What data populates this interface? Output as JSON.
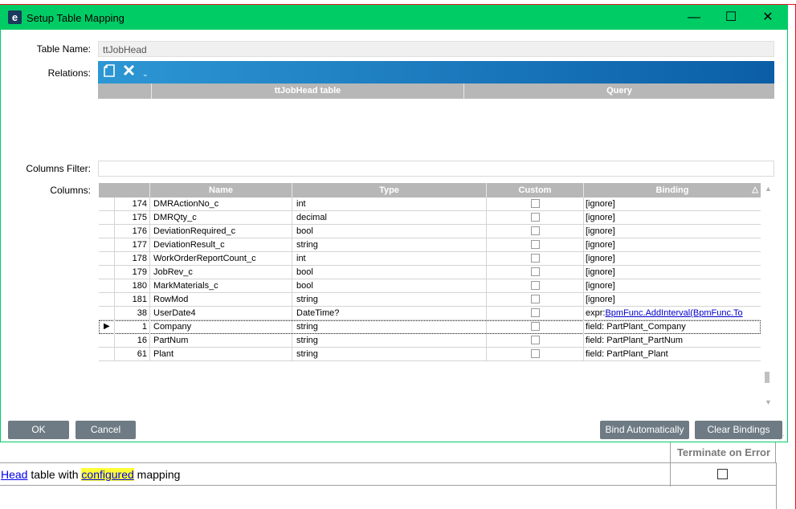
{
  "window": {
    "title": "Setup Table Mapping",
    "icon_letter": "e",
    "minimize_glyph": "—",
    "maximize_glyph": "☐",
    "close_glyph": "✕"
  },
  "form": {
    "table_name_label": "Table Name:",
    "table_name_value": "ttJobHead",
    "relations_label": "Relations:",
    "columns_filter_label": "Columns Filter:",
    "columns_filter_value": "",
    "columns_label": "Columns:"
  },
  "relations": {
    "toolbar_icons": [
      "new-document-icon",
      "delete-x-icon",
      "dropdown-caret-icon"
    ],
    "headers": [
      "ttJobHead table",
      "Query"
    ]
  },
  "columns_grid": {
    "headers": [
      "Name",
      "Type",
      "Custom",
      "Binding"
    ],
    "rows": [
      {
        "num": "174",
        "name": "DMRActionNo_c",
        "type": "int",
        "custom": false,
        "binding_prefix": "",
        "binding": "[ignore]"
      },
      {
        "num": "175",
        "name": "DMRQty_c",
        "type": "decimal",
        "custom": false,
        "binding_prefix": "",
        "binding": "[ignore]"
      },
      {
        "num": "176",
        "name": "DeviationRequired_c",
        "type": "bool",
        "custom": false,
        "binding_prefix": "",
        "binding": "[ignore]"
      },
      {
        "num": "177",
        "name": "DeviationResult_c",
        "type": "string",
        "custom": false,
        "binding_prefix": "",
        "binding": "[ignore]"
      },
      {
        "num": "178",
        "name": "WorkOrderReportCount_c",
        "type": "int",
        "custom": false,
        "binding_prefix": "",
        "binding": "[ignore]"
      },
      {
        "num": "179",
        "name": "JobRev_c",
        "type": "bool",
        "custom": false,
        "binding_prefix": "",
        "binding": "[ignore]"
      },
      {
        "num": "180",
        "name": "MarkMaterials_c",
        "type": "bool",
        "custom": false,
        "binding_prefix": "",
        "binding": "[ignore]"
      },
      {
        "num": "181",
        "name": "RowMod",
        "type": "string",
        "custom": false,
        "binding_prefix": "",
        "binding": "[ignore]"
      },
      {
        "num": "38",
        "name": "UserDate4",
        "type": "DateTime?",
        "custom": false,
        "binding_prefix": "expr:",
        "binding": "BpmFunc.AddInterval(BpmFunc.To"
      },
      {
        "num": "1",
        "name": "Company",
        "type": "string",
        "custom": false,
        "binding_prefix": "",
        "binding": "field: PartPlant_Company",
        "current": true
      },
      {
        "num": "16",
        "name": "PartNum",
        "type": "string",
        "custom": false,
        "binding_prefix": "",
        "binding": "field: PartPlant_PartNum"
      },
      {
        "num": "61",
        "name": "Plant",
        "type": "string",
        "custom": false,
        "binding_prefix": "",
        "binding": "field: PartPlant_Plant"
      }
    ]
  },
  "buttons": {
    "ok": "OK",
    "cancel": "Cancel",
    "bind_automatically": "Bind Automatically",
    "clear_bindings": "Clear Bindings"
  },
  "background": {
    "column_header": "Terminate on Error",
    "row_link": "Head",
    "row_text_1": " table with ",
    "row_highlight": "configured",
    "row_text_2": " mapping",
    "row_checked": false
  }
}
